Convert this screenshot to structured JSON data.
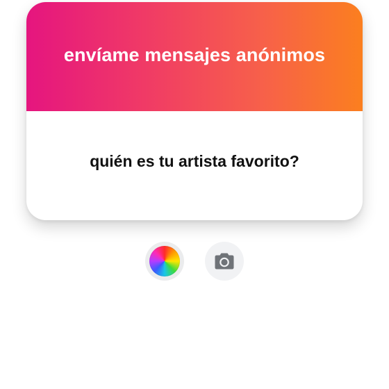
{
  "card": {
    "title": "envíame mensajes anónimos",
    "question": "quién es tu artista favorito?",
    "gradient_colors": [
      "#e5157f",
      "#f03a66",
      "#f7604a",
      "#fb7f1f"
    ]
  },
  "controls": {
    "color_button": {
      "icon": "color-wheel-icon"
    },
    "camera_button": {
      "icon": "camera-icon",
      "icon_color": "#6f7378"
    }
  }
}
